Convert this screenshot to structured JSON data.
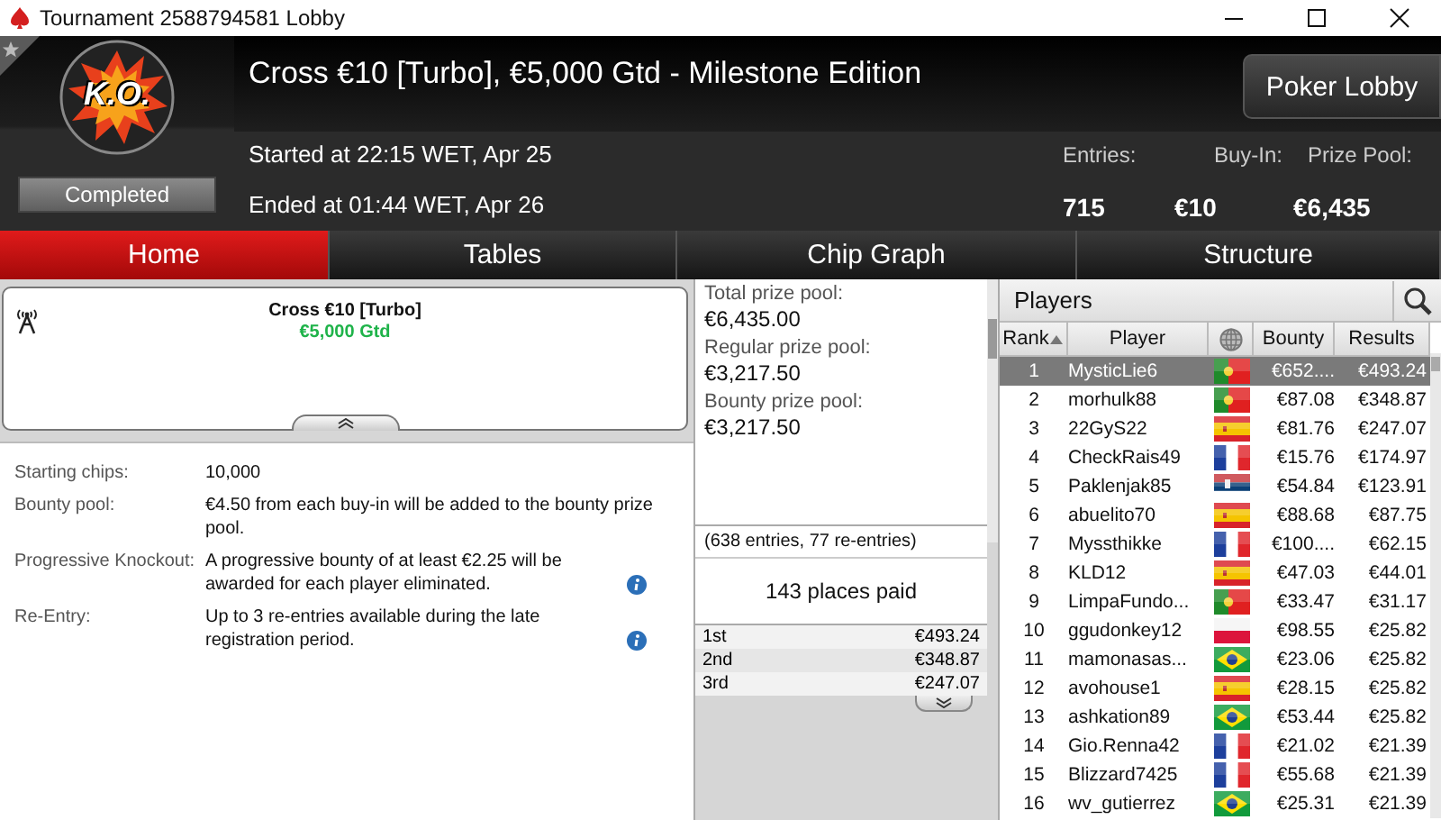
{
  "window": {
    "title": "Tournament 2588794581 Lobby"
  },
  "header": {
    "badge": "K.O.",
    "status": "Completed",
    "title": "Cross €10 [Turbo], €5,000 Gtd - Milestone Edition",
    "started": "Started at 22:15 WET, Apr 25",
    "ended": "Ended at 01:44 WET, Apr 26",
    "lobby_button": "Poker Lobby",
    "stats": [
      {
        "label": "Entries:",
        "value": "715"
      },
      {
        "label": "Buy-In:",
        "value": "€10"
      },
      {
        "label": "Prize Pool:",
        "value": "€6,435"
      }
    ]
  },
  "tabs": [
    {
      "label": "Home",
      "selected": true
    },
    {
      "label": "Tables",
      "selected": false
    },
    {
      "label": "Chip Graph",
      "selected": false
    },
    {
      "label": "Structure",
      "selected": false
    }
  ],
  "summary": {
    "name": "Cross €10 [Turbo]",
    "guarantee": "€5,000 Gtd"
  },
  "details": [
    {
      "label": "Starting chips:",
      "value": "10,000",
      "info": false
    },
    {
      "label": "Bounty pool:",
      "value": "€4.50 from each buy-in will be added to the bounty prize pool.",
      "info": false
    },
    {
      "label": "Progressive Knockout:",
      "value": "A progressive bounty of at least €2.25 will be awarded for each player eliminated.",
      "info": true
    },
    {
      "label": "Re-Entry:",
      "value": "Up to 3 re-entries available during the late registration period.",
      "info": true
    }
  ],
  "prize_pool": {
    "items": [
      {
        "label": "Total prize pool:",
        "value": "€6,435.00"
      },
      {
        "label": "Regular prize pool:",
        "value": "€3,217.50"
      },
      {
        "label": "Bounty prize pool:",
        "value": "€3,217.50"
      }
    ],
    "entries_note": "(638 entries, 77 re-entries)",
    "places_paid": "143 places paid",
    "payouts": [
      {
        "place": "1st",
        "amount": "€493.24"
      },
      {
        "place": "2nd",
        "amount": "€348.87"
      },
      {
        "place": "3rd",
        "amount": "€247.07"
      }
    ]
  },
  "players": {
    "title": "Players",
    "columns": [
      "Rank",
      "Player",
      "Bounty",
      "Results"
    ],
    "rows": [
      {
        "rank": "1",
        "name": "MysticLie6",
        "kind": "pt",
        "bounty": "€652....",
        "result": "€493.24",
        "selected": true
      },
      {
        "rank": "2",
        "name": "morhulk88",
        "kind": "pt",
        "bounty": "€87.08",
        "result": "€348.87",
        "selected": false
      },
      {
        "rank": "3",
        "name": "22GyS22",
        "kind": "es",
        "bounty": "€81.76",
        "result": "€247.07",
        "selected": false
      },
      {
        "rank": "4",
        "name": "CheckRais49",
        "kind": "fr",
        "bounty": "€15.76",
        "result": "€174.97",
        "selected": false
      },
      {
        "rank": "5",
        "name": "Paklenjak85",
        "kind": "rs",
        "bounty": "€54.84",
        "result": "€123.91",
        "selected": false
      },
      {
        "rank": "6",
        "name": "abuelito70",
        "kind": "es",
        "bounty": "€88.68",
        "result": "€87.75",
        "selected": false
      },
      {
        "rank": "7",
        "name": "Myssthikke",
        "kind": "fr",
        "bounty": "€100....",
        "result": "€62.15",
        "selected": false
      },
      {
        "rank": "8",
        "name": "KLD12",
        "kind": "es",
        "bounty": "€47.03",
        "result": "€44.01",
        "selected": false
      },
      {
        "rank": "9",
        "name": "LimpaFundo...",
        "kind": "pt",
        "bounty": "€33.47",
        "result": "€31.17",
        "selected": false
      },
      {
        "rank": "10",
        "name": "ggudonkey12",
        "kind": "pl",
        "bounty": "€98.55",
        "result": "€25.82",
        "selected": false
      },
      {
        "rank": "11",
        "name": "mamonasas...",
        "kind": "br",
        "bounty": "€23.06",
        "result": "€25.82",
        "selected": false
      },
      {
        "rank": "12",
        "name": "avohouse1",
        "kind": "es",
        "bounty": "€28.15",
        "result": "€25.82",
        "selected": false
      },
      {
        "rank": "13",
        "name": "ashkation89",
        "kind": "br",
        "bounty": "€53.44",
        "result": "€25.82",
        "selected": false
      },
      {
        "rank": "14",
        "name": "Gio.Renna42",
        "kind": "fr",
        "bounty": "€21.02",
        "result": "€21.39",
        "selected": false
      },
      {
        "rank": "15",
        "name": "Blizzard7425",
        "kind": "fr",
        "bounty": "€55.68",
        "result": "€21.39",
        "selected": false
      },
      {
        "rank": "16",
        "name": "wv_gutierrez",
        "kind": "br",
        "bounty": "€25.31",
        "result": "€21.39",
        "selected": false
      }
    ]
  }
}
